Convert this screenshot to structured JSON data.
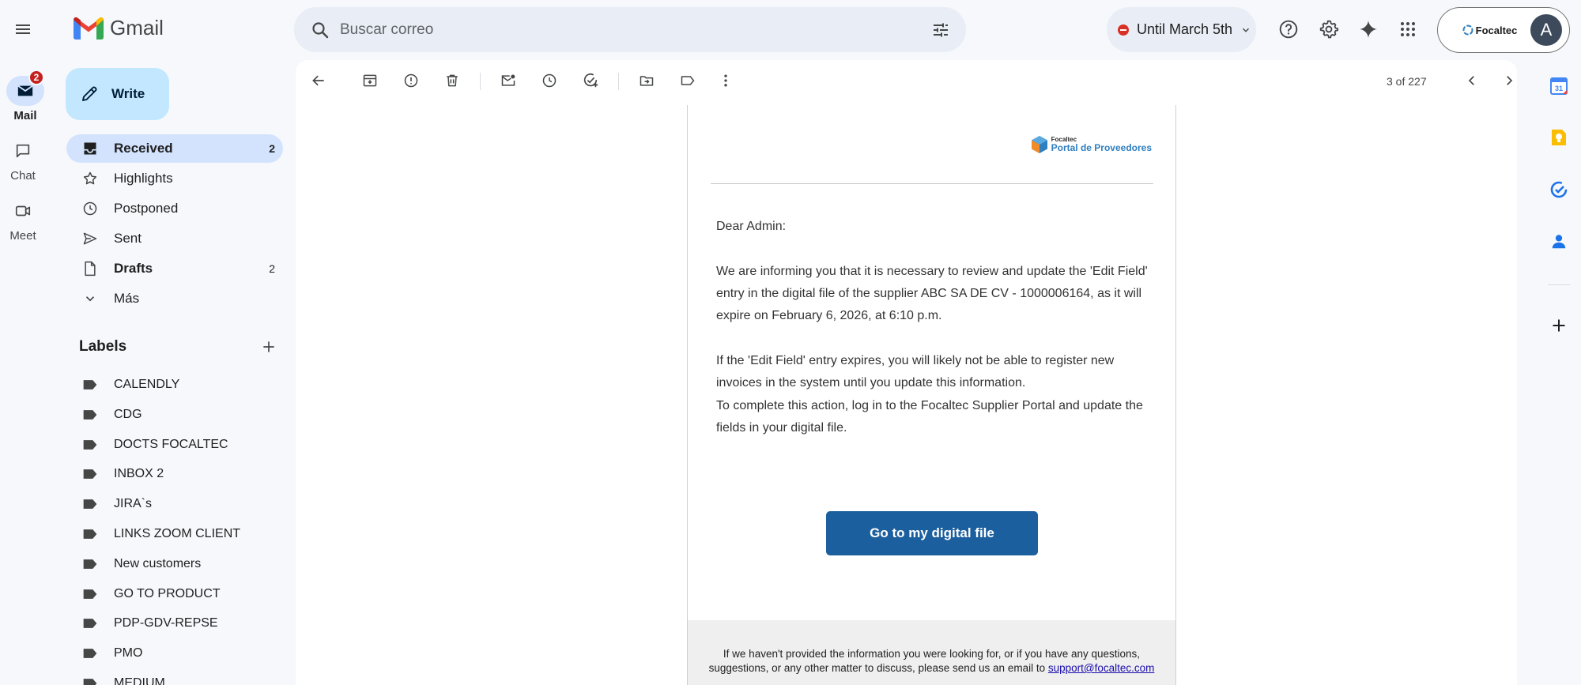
{
  "app": {
    "name": "Gmail"
  },
  "rail": {
    "items": [
      {
        "label": "Mail",
        "badge": "2"
      },
      {
        "label": "Chat"
      },
      {
        "label": "Meet"
      }
    ]
  },
  "search": {
    "placeholder": "Buscar correo"
  },
  "status": {
    "label": "Until March 5th"
  },
  "account": {
    "org": "Focaltec",
    "initial": "A"
  },
  "compose": {
    "label": "Write"
  },
  "nav": [
    {
      "label": "Received",
      "count": "2"
    },
    {
      "label": "Highlights"
    },
    {
      "label": "Postponed"
    },
    {
      "label": "Sent"
    },
    {
      "label": "Drafts",
      "count": "2"
    },
    {
      "label": "Más"
    }
  ],
  "labels": {
    "title": "Labels",
    "items": [
      "CALENDLY",
      "CDG",
      "DOCTS FOCALTEC",
      "INBOX 2",
      "JIRA`s",
      "LINKS ZOOM CLIENT",
      "New customers",
      "GO TO PRODUCT",
      "PDP-GDV-REPSE",
      "PMO",
      "MEDIUM"
    ]
  },
  "toolbar": {
    "pager": "3 of 227"
  },
  "email": {
    "brand_small": "Focaltec",
    "brand_big": "Portal de Proveedores",
    "greeting": "Dear Admin:",
    "p1": "We are informing you that it is necessary to review and update the 'Edit Field' entry in the digital file of the supplier ABC                          SA DE CV - 1000006164, as it will expire on February 6, 2026, at 6:10 p.m.",
    "p2": "If the 'Edit Field' entry expires, you will likely not be able to register new invoices in the system until you update this information.",
    "p3": "To complete this action, log in to the Focaltec Supplier Portal and update the fields in your digital file.",
    "cta": "Go to my digital file",
    "footer": "If we haven't provided the information you were looking for, or if you have any questions, suggestions, or any other matter to discuss, please send us an email to",
    "footer_link": "support@focaltec.com"
  },
  "colors": {
    "accent": "#0b57d0",
    "compose_bg": "#c2e7ff",
    "cta_bg": "#1c5f9e",
    "badge": "#c5221f"
  }
}
